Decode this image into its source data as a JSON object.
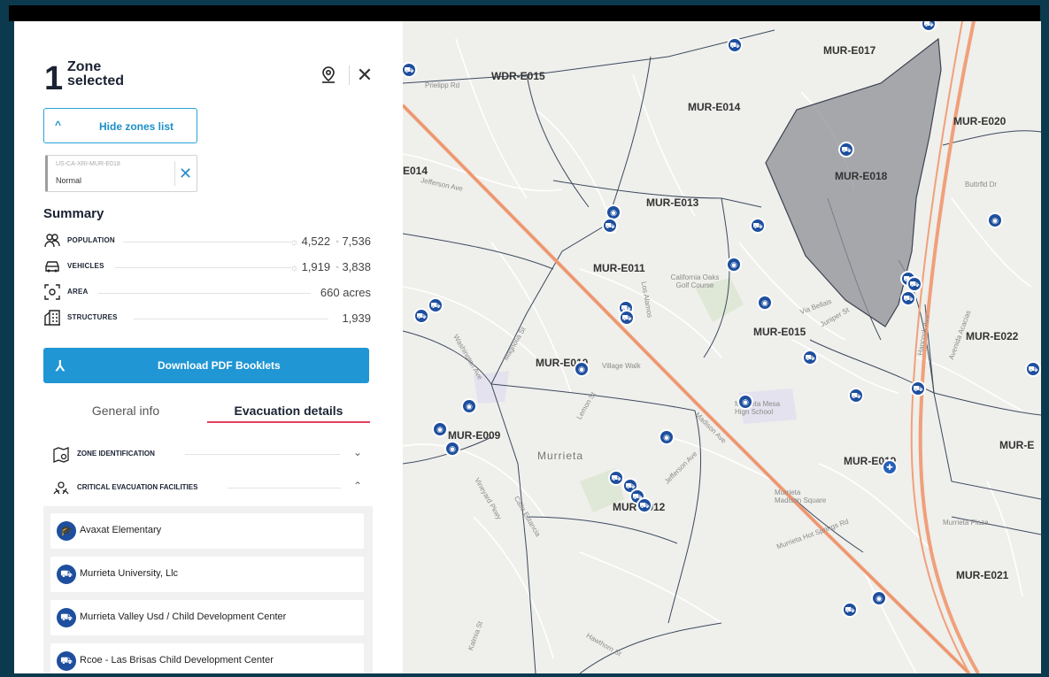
{
  "panel": {
    "zone_count": "1",
    "zone_word_line1": "Zone",
    "zone_word_line2": "selected",
    "close_glyph": "✕",
    "hide_zones_label": "Hide zones list",
    "hide_zones_chevron": "^",
    "chip": {
      "zone_id": "US-CA-XRI-MUR-E018",
      "status": "Normal",
      "remove_glyph": "✕"
    },
    "summary_title": "Summary",
    "summary_rows": [
      {
        "icon": "people-icon",
        "label": "POPULATION",
        "value_a": "4,522",
        "value_b": "7,536"
      },
      {
        "icon": "car-icon",
        "label": "VEHICLES",
        "value_a": "1,919",
        "value_b": "3,838"
      },
      {
        "icon": "area-icon",
        "label": "AREA",
        "value": "660 acres"
      },
      {
        "icon": "building-icon",
        "label": "STRUCTURES",
        "value": "1,939"
      }
    ],
    "pdf_button_label": "Download PDF Booklets",
    "tabs": {
      "general": "General info",
      "evacuation": "Evacuation details"
    },
    "accordions": [
      {
        "label": "ZONE IDENTIFICATION",
        "icon": "zone-map-icon",
        "expanded": false
      },
      {
        "label": "CRITICAL EVACUATION FACILITIES",
        "icon": "facility-hands-icon",
        "expanded": true
      }
    ],
    "facilities": [
      {
        "name": "Avaxat Elementary",
        "icon": "school-icon"
      },
      {
        "name": "Murrieta University, Llc",
        "icon": "childcare-icon"
      },
      {
        "name": "Murrieta Valley Usd / Child Development Center",
        "icon": "childcare-icon"
      },
      {
        "name": "Rcoe - Las Brisas Child Development Center",
        "icon": "childcare-icon"
      }
    ]
  },
  "map": {
    "zone_labels": [
      "MUR-E017",
      "WDR-E015",
      "MUR-E014",
      "MUR-E020",
      "MUR-E018",
      "E014",
      "MUR-E013",
      "MUR-E011",
      "MUR-E015",
      "MUR-E022",
      "MUR-E010",
      "MUR-E009",
      "MUR-E",
      "MUR-E019",
      "MUR-E012",
      "MUR-E021"
    ],
    "city_label": "Murrieta",
    "street_labels": [
      "Prielipp Rd",
      "Jefferson Ave",
      "Magnolia St",
      "Lemon St",
      "Madison Ave",
      "Juniper St",
      "Via Bellais",
      "Kalmia St",
      "Hawthorn St",
      "Murrieta Hot Springs Rd",
      "Hancock Ave",
      "Avenida Acacias",
      "Buttrfld Dr",
      "Washington Ave",
      "Vineyard Pkwy",
      "Calle Estancia",
      "Jefferson Ave",
      "Los Alamos",
      "California Oaks Golf Course",
      "Village Walk",
      "Murrieta Mesa High School",
      "Murrieta Madison Square",
      "Murrieta Plaza"
    ],
    "selected_zone_fill": "#8d8f96",
    "highway_color": "#f0a07a",
    "poi_color": "#1e4f9e"
  },
  "colors": {
    "accent": "#2096d4",
    "tab_underline": "#e3425e",
    "frame": "#0b3a4e"
  }
}
